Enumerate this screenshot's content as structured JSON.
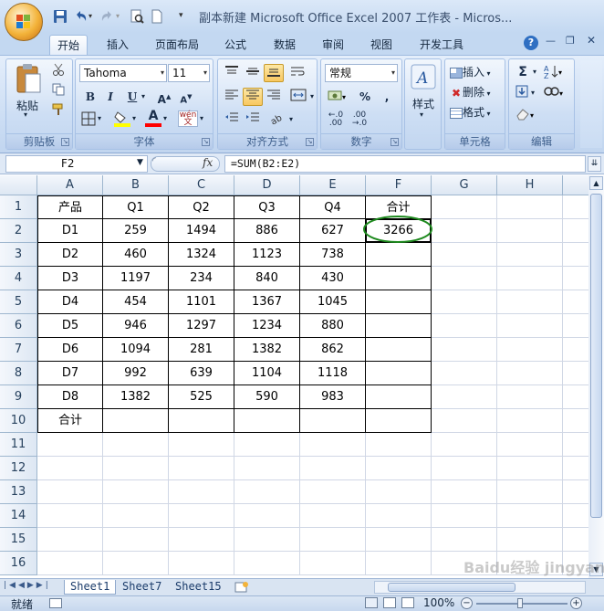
{
  "window": {
    "title": "副本新建 Microsoft Office Excel 2007 工作表 - Micros..."
  },
  "tabs": [
    "开始",
    "插入",
    "页面布局",
    "公式",
    "数据",
    "审阅",
    "视图",
    "开发工具"
  ],
  "ribbon": {
    "clipboard": {
      "label": "剪贴板",
      "paste": "粘贴"
    },
    "font": {
      "label": "字体",
      "font_name": "Tahoma",
      "font_size": "11",
      "bold": "B",
      "italic": "I",
      "underline": "U"
    },
    "alignment": {
      "label": "对齐方式"
    },
    "number": {
      "label": "数字",
      "format": "常规",
      "percent": "%",
      "comma": ","
    },
    "styles": {
      "label": "样式"
    },
    "cells": {
      "label": "单元格",
      "insert": "插入",
      "delete": "删除",
      "format": "格式"
    },
    "editing": {
      "label": "编辑",
      "sum": "Σ"
    }
  },
  "formula_bar": {
    "name_box": "F2",
    "fx": "fx",
    "formula": "=SUM(B2:E2)"
  },
  "columns": [
    "A",
    "B",
    "C",
    "D",
    "E",
    "F",
    "G",
    "H"
  ],
  "rows": [
    "1",
    "2",
    "3",
    "4",
    "5",
    "6",
    "7",
    "8",
    "9",
    "10",
    "11",
    "12",
    "13",
    "14",
    "15",
    "16"
  ],
  "cells": [
    [
      "产品",
      "Q1",
      "Q2",
      "Q3",
      "Q4",
      "合计"
    ],
    [
      "D1",
      "259",
      "1494",
      "886",
      "627",
      "3266"
    ],
    [
      "D2",
      "460",
      "1324",
      "1123",
      "738",
      ""
    ],
    [
      "D3",
      "1197",
      "234",
      "840",
      "430",
      ""
    ],
    [
      "D4",
      "454",
      "1101",
      "1367",
      "1045",
      ""
    ],
    [
      "D5",
      "946",
      "1297",
      "1234",
      "880",
      ""
    ],
    [
      "D6",
      "1094",
      "281",
      "1382",
      "862",
      ""
    ],
    [
      "D7",
      "992",
      "639",
      "1104",
      "1118",
      ""
    ],
    [
      "D8",
      "1382",
      "525",
      "590",
      "983",
      ""
    ],
    [
      "合计",
      "",
      "",
      "",
      "",
      ""
    ]
  ],
  "sheet_tabs": [
    "Sheet1",
    "Sheet7",
    "Sheet15"
  ],
  "status": {
    "ready": "就绪",
    "zoom": "100%"
  },
  "watermark": "Baidu经验 jingyan.baidu.com",
  "colors": {
    "highlight_ellipse": "#1e8a1e",
    "ribbon": "#cadcf3",
    "grid": "#d0d7e5"
  }
}
